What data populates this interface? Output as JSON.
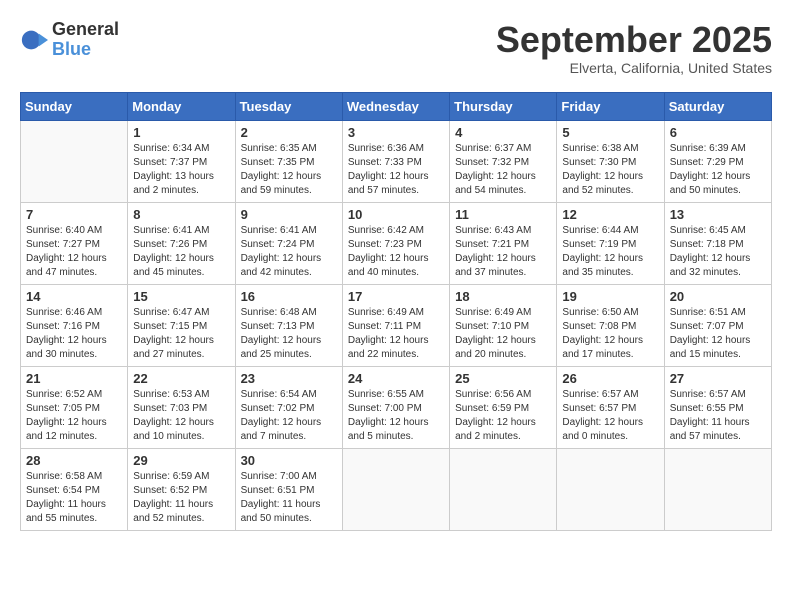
{
  "logo": {
    "general": "General",
    "blue": "Blue"
  },
  "title": "September 2025",
  "location": "Elverta, California, United States",
  "days_of_week": [
    "Sunday",
    "Monday",
    "Tuesday",
    "Wednesday",
    "Thursday",
    "Friday",
    "Saturday"
  ],
  "weeks": [
    [
      {
        "day": "",
        "info": ""
      },
      {
        "day": "1",
        "info": "Sunrise: 6:34 AM\nSunset: 7:37 PM\nDaylight: 13 hours\nand 2 minutes."
      },
      {
        "day": "2",
        "info": "Sunrise: 6:35 AM\nSunset: 7:35 PM\nDaylight: 12 hours\nand 59 minutes."
      },
      {
        "day": "3",
        "info": "Sunrise: 6:36 AM\nSunset: 7:33 PM\nDaylight: 12 hours\nand 57 minutes."
      },
      {
        "day": "4",
        "info": "Sunrise: 6:37 AM\nSunset: 7:32 PM\nDaylight: 12 hours\nand 54 minutes."
      },
      {
        "day": "5",
        "info": "Sunrise: 6:38 AM\nSunset: 7:30 PM\nDaylight: 12 hours\nand 52 minutes."
      },
      {
        "day": "6",
        "info": "Sunrise: 6:39 AM\nSunset: 7:29 PM\nDaylight: 12 hours\nand 50 minutes."
      }
    ],
    [
      {
        "day": "7",
        "info": "Sunrise: 6:40 AM\nSunset: 7:27 PM\nDaylight: 12 hours\nand 47 minutes."
      },
      {
        "day": "8",
        "info": "Sunrise: 6:41 AM\nSunset: 7:26 PM\nDaylight: 12 hours\nand 45 minutes."
      },
      {
        "day": "9",
        "info": "Sunrise: 6:41 AM\nSunset: 7:24 PM\nDaylight: 12 hours\nand 42 minutes."
      },
      {
        "day": "10",
        "info": "Sunrise: 6:42 AM\nSunset: 7:23 PM\nDaylight: 12 hours\nand 40 minutes."
      },
      {
        "day": "11",
        "info": "Sunrise: 6:43 AM\nSunset: 7:21 PM\nDaylight: 12 hours\nand 37 minutes."
      },
      {
        "day": "12",
        "info": "Sunrise: 6:44 AM\nSunset: 7:19 PM\nDaylight: 12 hours\nand 35 minutes."
      },
      {
        "day": "13",
        "info": "Sunrise: 6:45 AM\nSunset: 7:18 PM\nDaylight: 12 hours\nand 32 minutes."
      }
    ],
    [
      {
        "day": "14",
        "info": "Sunrise: 6:46 AM\nSunset: 7:16 PM\nDaylight: 12 hours\nand 30 minutes."
      },
      {
        "day": "15",
        "info": "Sunrise: 6:47 AM\nSunset: 7:15 PM\nDaylight: 12 hours\nand 27 minutes."
      },
      {
        "day": "16",
        "info": "Sunrise: 6:48 AM\nSunset: 7:13 PM\nDaylight: 12 hours\nand 25 minutes."
      },
      {
        "day": "17",
        "info": "Sunrise: 6:49 AM\nSunset: 7:11 PM\nDaylight: 12 hours\nand 22 minutes."
      },
      {
        "day": "18",
        "info": "Sunrise: 6:49 AM\nSunset: 7:10 PM\nDaylight: 12 hours\nand 20 minutes."
      },
      {
        "day": "19",
        "info": "Sunrise: 6:50 AM\nSunset: 7:08 PM\nDaylight: 12 hours\nand 17 minutes."
      },
      {
        "day": "20",
        "info": "Sunrise: 6:51 AM\nSunset: 7:07 PM\nDaylight: 12 hours\nand 15 minutes."
      }
    ],
    [
      {
        "day": "21",
        "info": "Sunrise: 6:52 AM\nSunset: 7:05 PM\nDaylight: 12 hours\nand 12 minutes."
      },
      {
        "day": "22",
        "info": "Sunrise: 6:53 AM\nSunset: 7:03 PM\nDaylight: 12 hours\nand 10 minutes."
      },
      {
        "day": "23",
        "info": "Sunrise: 6:54 AM\nSunset: 7:02 PM\nDaylight: 12 hours\nand 7 minutes."
      },
      {
        "day": "24",
        "info": "Sunrise: 6:55 AM\nSunset: 7:00 PM\nDaylight: 12 hours\nand 5 minutes."
      },
      {
        "day": "25",
        "info": "Sunrise: 6:56 AM\nSunset: 6:59 PM\nDaylight: 12 hours\nand 2 minutes."
      },
      {
        "day": "26",
        "info": "Sunrise: 6:57 AM\nSunset: 6:57 PM\nDaylight: 12 hours\nand 0 minutes."
      },
      {
        "day": "27",
        "info": "Sunrise: 6:57 AM\nSunset: 6:55 PM\nDaylight: 11 hours\nand 57 minutes."
      }
    ],
    [
      {
        "day": "28",
        "info": "Sunrise: 6:58 AM\nSunset: 6:54 PM\nDaylight: 11 hours\nand 55 minutes."
      },
      {
        "day": "29",
        "info": "Sunrise: 6:59 AM\nSunset: 6:52 PM\nDaylight: 11 hours\nand 52 minutes."
      },
      {
        "day": "30",
        "info": "Sunrise: 7:00 AM\nSunset: 6:51 PM\nDaylight: 11 hours\nand 50 minutes."
      },
      {
        "day": "",
        "info": ""
      },
      {
        "day": "",
        "info": ""
      },
      {
        "day": "",
        "info": ""
      },
      {
        "day": "",
        "info": ""
      }
    ]
  ]
}
